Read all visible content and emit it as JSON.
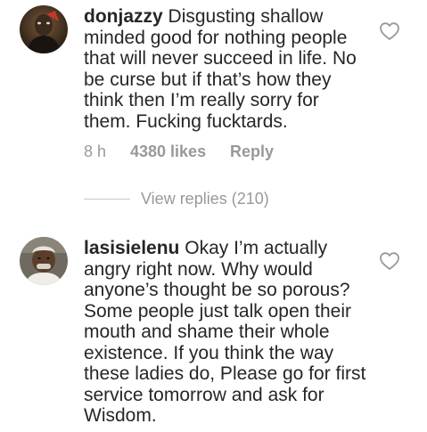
{
  "comments": [
    {
      "username": "donjazzy",
      "text": "Disgusting shallow minded good for nothing people that will never succeed in life. No be curse but if that’s how they think then I’m really sorry for them. Fucking fucktards.",
      "time": "8 h",
      "likes": "4380 likes",
      "reply_label": "Reply",
      "view_replies": "View replies (210)",
      "heart_icon": "heart-outline-icon"
    },
    {
      "username": "lasisielenu",
      "text": "Okay I’m actually angry right now. Why would anyone’s thought be so porous? Some people just talk open their mouth and shame their whole existence. If you think the  way these ladies do, Please go for first service tomorrow and ask for Wisdom.",
      "heart_icon": "heart-outline-icon"
    }
  ],
  "colors": {
    "text": "#262626",
    "meta": "#999999",
    "divider": "#c7c7c7"
  }
}
